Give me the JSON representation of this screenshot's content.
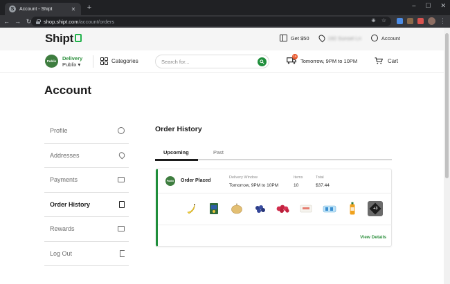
{
  "browser": {
    "tab_title": "Account - Shipt",
    "tab_favicon": "S",
    "url_host": "shop.shipt.com",
    "url_path": "/account/orders"
  },
  "header": {
    "logo": "Shipt",
    "get_credit": "Get $50",
    "address_blurred": "192 Sunset Ln",
    "account": "Account"
  },
  "store_bar": {
    "store_badge": "Publix",
    "mode": "Delivery",
    "store_name": "Publix",
    "categories": "Categories",
    "search_placeholder": "Search for...",
    "delivery_badge_count": "16",
    "delivery_window": "Tomorrow, 9PM to 10PM",
    "cart": "Cart"
  },
  "page": {
    "title": "Account"
  },
  "sidebar": {
    "items": [
      {
        "label": "Profile",
        "icon": "user-icon",
        "active": false
      },
      {
        "label": "Addresses",
        "icon": "location-pin-icon",
        "active": false
      },
      {
        "label": "Payments",
        "icon": "credit-card-icon",
        "active": false
      },
      {
        "label": "Order History",
        "icon": "receipt-icon",
        "active": true
      },
      {
        "label": "Rewards",
        "icon": "gift-icon",
        "active": false
      },
      {
        "label": "Log Out",
        "icon": "logout-icon",
        "active": false
      }
    ]
  },
  "order_history": {
    "title": "Order History",
    "tabs": [
      "Upcoming",
      "Past"
    ],
    "active_tab": "Upcoming",
    "order": {
      "store_badge": "Publix",
      "status": "Order Placed",
      "window_label": "Delivery Window",
      "window_value": "Tomorrow, 9PM to 10PM",
      "items_label": "Items",
      "items_value": "10",
      "total_label": "Total",
      "total_value": "$37.44",
      "products": [
        "banana-icon",
        "cereal-box-icon",
        "onion-icon",
        "blueberries-icon",
        "raspberries-icon",
        "tofu-package-icon",
        "water-bottles-icon",
        "juice-bottle-icon"
      ],
      "more_label": "+3",
      "view_details": "View Details"
    }
  },
  "colors": {
    "brand_green": "#1f8e3b",
    "badge_orange": "#e8562a"
  }
}
